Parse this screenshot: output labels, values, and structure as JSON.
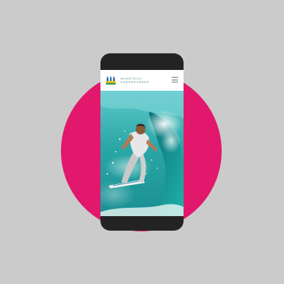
{
  "app": {
    "brand_line1": "WAKETECH",
    "brand_line2": "SURFBOARDER"
  },
  "header": {
    "logo_icon": "surfboards-logo-icon",
    "menu_icon": "hamburger-menu-icon"
  },
  "hero": {
    "image": "surfer-riding-wave-photo"
  },
  "colors": {
    "background": "#cbcbcb",
    "accent_circle": "#e2186d",
    "phone_frame": "#232323",
    "brand_text": "#5b9a9d",
    "wave_teal": "#2fb5b0"
  }
}
